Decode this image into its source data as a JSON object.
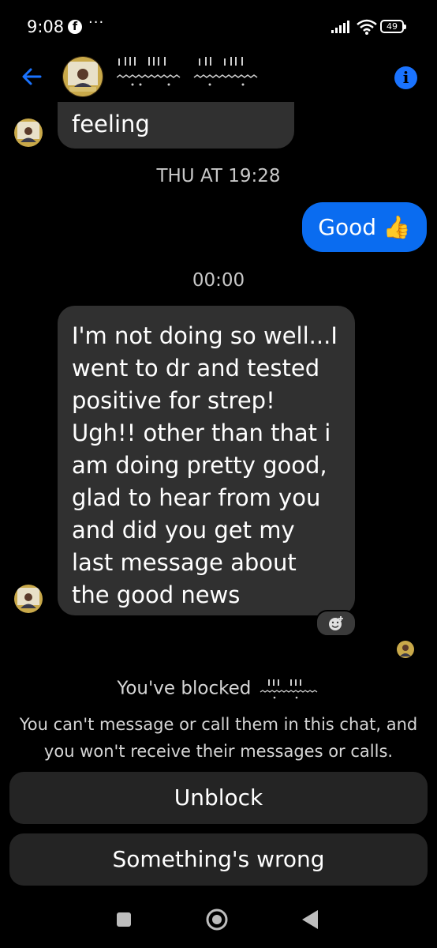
{
  "status_bar": {
    "time": "9:08",
    "notification_icon": "facebook-icon",
    "more_indicator": "···",
    "battery_level": "49"
  },
  "header": {
    "contact_name": "",
    "back_icon": "arrow-left-icon",
    "info_icon": "info-icon",
    "info_glyph": "i"
  },
  "messages": {
    "first_text": "feeling",
    "timestamp_1": "THU AT 19:28",
    "sent_text": "Good 👍",
    "timestamp_2": "00:00",
    "long_text": "I'm not doing so well...I went to dr and tested positive for strep! Ugh!! other than that i am doing pretty good, glad to hear from you and did you get my last message about the good news"
  },
  "blocked": {
    "title_prefix": "You've blocked",
    "description": "You can't message or call them in this chat, and you won't receive their messages or calls.",
    "unblock_label": "Unblock",
    "wrong_label": "Something's wrong"
  },
  "colors": {
    "accent": "#0a6cf0",
    "bubble_incoming": "#303030",
    "background": "#000000",
    "button_bg": "#242424"
  }
}
